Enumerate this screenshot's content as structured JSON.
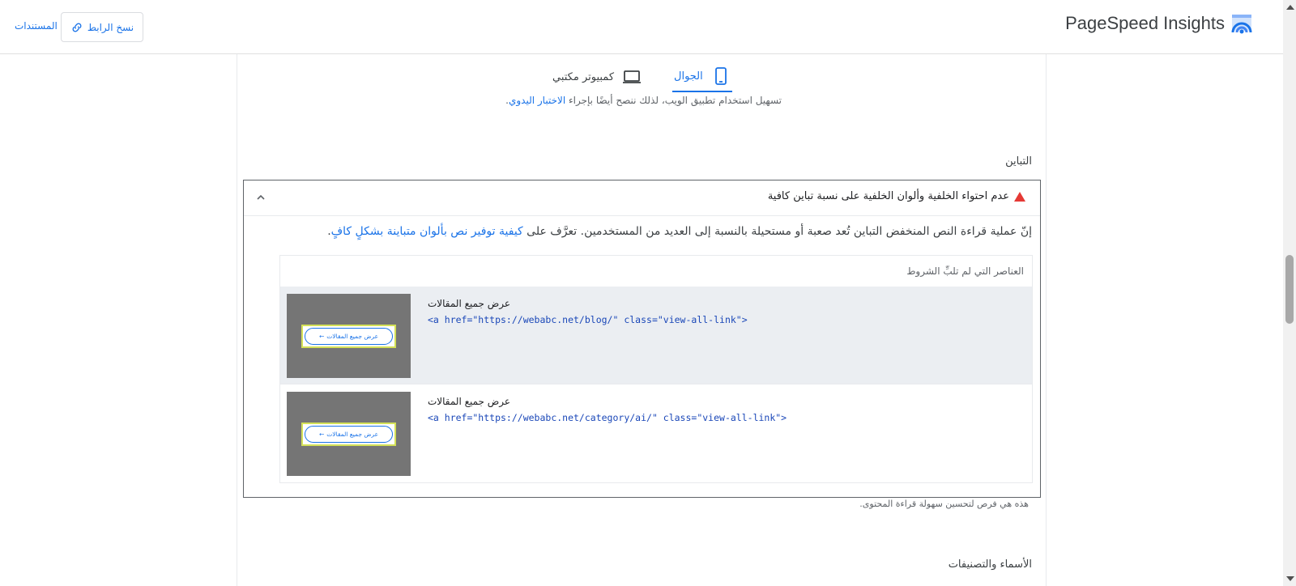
{
  "header": {
    "app_title": "PageSpeed Insights",
    "copy_link_label": "نسخ الرابط",
    "docs_label": "المستندات"
  },
  "tabs": [
    {
      "label": "الجوال",
      "icon": "smartphone-icon",
      "active": true
    },
    {
      "label": "كمبيوتر مكتبي",
      "icon": "laptop-icon",
      "active": false
    }
  ],
  "intro": {
    "text": "تسهيل استخدام تطبيق الويب، لذلك ننصح أيضًا بإجراء ",
    "link": "الاختبار اليدوي",
    "suffix": "."
  },
  "contrast_section": {
    "title": "التباين",
    "audit_title": "عدم احتواء الخلفية وألوان الخلفية على نسبة تباين كافية",
    "audit_status_color": "#e53935",
    "description": "إنّ عملية قراءة النص المنخفض التباين تُعد صعبة أو مستحيلة بالنسبة إلى العديد من المستخدمين. تعرَّف على ",
    "description_link": "كيفية توفير نص بألوان متباينة بشكلٍ كافٍ",
    "description_suffix": ".",
    "failing_header": "العناصر التي لم تلبِّ الشروط",
    "items": [
      {
        "label": "عرض جميع المقالات",
        "code": "<a href=\"https://webabc.net/blog/\" class=\"view-all-link\">",
        "thumb_text": "عرض جميع المقالات"
      },
      {
        "label": "عرض جميع المقالات",
        "code": "<a href=\"https://webabc.net/category/ai/\" class=\"view-all-link\">",
        "thumb_text": "عرض جميع المقالات"
      }
    ],
    "footer_note": "هذه هي فرص لتحسين سهولة قراءة المحتوى."
  },
  "names_section": {
    "title": "الأسماء والتصنيفات"
  }
}
